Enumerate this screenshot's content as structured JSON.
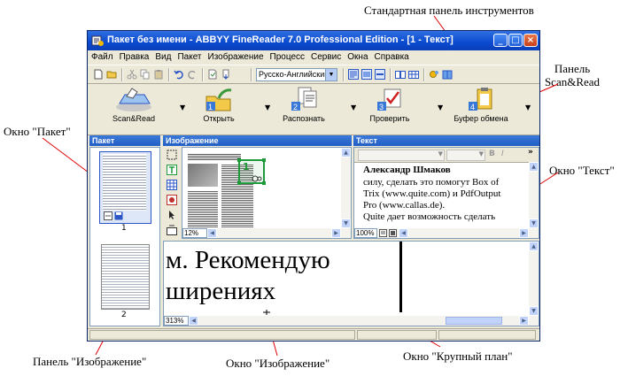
{
  "callouts": {
    "standard_toolbar": "Стандартная панель инструментов",
    "scanread_panel_line1": "Панель",
    "scanread_panel_line2": "Scan&Read",
    "batch_window": "Окно \"Пакет\"",
    "text_window": "Окно \"Текст\"",
    "image_panel": "Панель \"Изображение\"",
    "image_window": "Окно \"Изображение\"",
    "zoom_window": "Окно \"Крупный план\""
  },
  "window": {
    "title": "Пакет без имени - ABBYY FineReader 7.0 Professional Edition - [1 - Текст]"
  },
  "menu": [
    "Файл",
    "Правка",
    "Вид",
    "Пакет",
    "Изображение",
    "Процесс",
    "Сервис",
    "Окна",
    "Справка"
  ],
  "toolbar": {
    "language": "Русско-Английский"
  },
  "scanread": {
    "buttons": [
      {
        "label": "Scan&Read"
      },
      {
        "label": "Открыть",
        "step": "1"
      },
      {
        "label": "Распознать",
        "step": "2"
      },
      {
        "label": "Проверить",
        "step": "3"
      },
      {
        "label": "Буфер обмена",
        "step": "4"
      }
    ]
  },
  "panes": {
    "batch": {
      "header": "Пакет",
      "page_number": "1",
      "page2_number": "2"
    },
    "image": {
      "header": "Изображение",
      "zoom": "12%",
      "block_number": "1"
    },
    "text": {
      "header": "Текст",
      "zoom": "100%",
      "lines": [
        "Александр Шмаков",
        "силу, сделать это помогут Box of",
        "Trix (www.quite.com) и PdfOutput",
        "Pro (www.callas.de).",
        "Quite дает возможность сделать"
      ]
    },
    "zoom_view": {
      "zoom": "313%",
      "line1": "м. Рекомендую",
      "line2": "ширениях"
    }
  },
  "colors": {
    "title_bar": "#0a4ad0",
    "pane_header": "#225fc6",
    "selection": "#1e9a3a"
  }
}
